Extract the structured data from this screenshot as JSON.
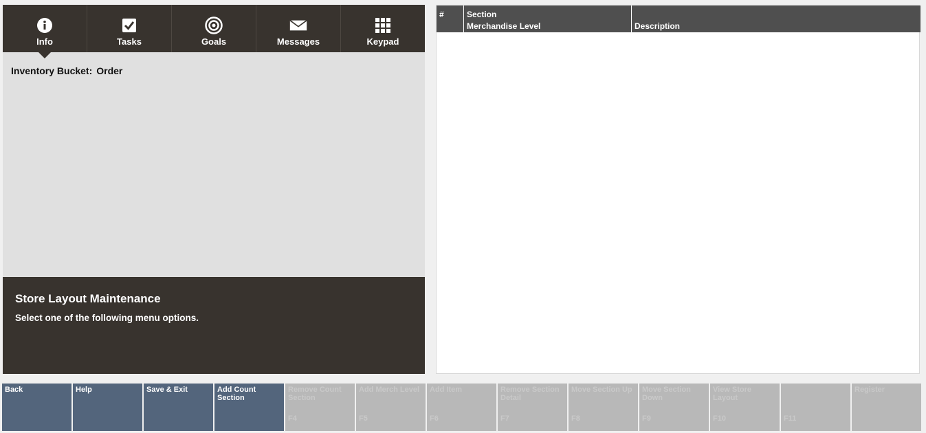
{
  "tabs": [
    {
      "label": "Info",
      "icon": "info-icon",
      "active": true
    },
    {
      "label": "Tasks",
      "icon": "checkbox-icon",
      "active": false
    },
    {
      "label": "Goals",
      "icon": "target-icon",
      "active": false
    },
    {
      "label": "Messages",
      "icon": "envelope-icon",
      "active": false
    },
    {
      "label": "Keypad",
      "icon": "keypad-grid-icon",
      "active": false
    }
  ],
  "info": {
    "bucket_label": "Inventory Bucket:",
    "bucket_value": "Order"
  },
  "prompt": {
    "title": "Store Layout Maintenance",
    "text": "Select one of the following menu options."
  },
  "table": {
    "col_num": "#",
    "col_section_line1": "Section",
    "col_section_line2": "Merchandise Level",
    "col_description": "Description",
    "rows": []
  },
  "function_keys": [
    {
      "label": "Back",
      "code": "",
      "enabled": true
    },
    {
      "label": "Help",
      "code": "",
      "enabled": true
    },
    {
      "label": "Save & Exit",
      "code": "",
      "enabled": true
    },
    {
      "label": "Add Count Section",
      "code": "",
      "enabled": true
    },
    {
      "label": "Remove Count Section",
      "code": "F4",
      "enabled": false
    },
    {
      "label": "Add Merch Level",
      "code": "F5",
      "enabled": false
    },
    {
      "label": "Add Item",
      "code": "F6",
      "enabled": false
    },
    {
      "label": "Remove Section Detail",
      "code": "F7",
      "enabled": false
    },
    {
      "label": "Move Section Up",
      "code": "F8",
      "enabled": false
    },
    {
      "label": "Move Section Down",
      "code": "F9",
      "enabled": false
    },
    {
      "label": "View Store Layout",
      "code": "F10",
      "enabled": false
    },
    {
      "label": "",
      "code": "F11",
      "enabled": false
    },
    {
      "label": "Register",
      "code": "",
      "enabled": false
    }
  ],
  "colors": {
    "dark_panel": "#38332e",
    "table_header": "#4f4f4f",
    "key_enabled": "#53657c",
    "key_disabled": "#b8b8b8"
  }
}
